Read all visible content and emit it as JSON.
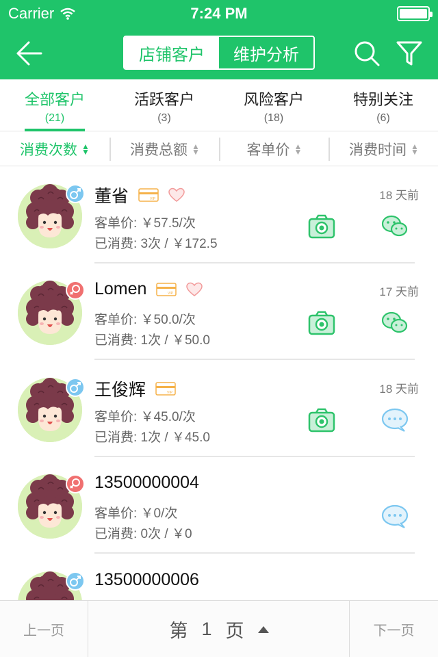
{
  "status": {
    "carrier": "Carrier",
    "time": "7:24 PM"
  },
  "header": {
    "segments": [
      {
        "label": "店铺客户",
        "active": true
      },
      {
        "label": "维护分析",
        "active": false
      }
    ],
    "icons": {
      "back": "back-arrow-icon",
      "search": "search-icon",
      "filter": "filter-icon"
    }
  },
  "tabs": [
    {
      "label": "全部客户",
      "count": "(21)",
      "active": true
    },
    {
      "label": "活跃客户",
      "count": "(3)",
      "active": false
    },
    {
      "label": "风险客户",
      "count": "(18)",
      "active": false
    },
    {
      "label": "特别关注",
      "count": "(6)",
      "active": false
    }
  ],
  "sort": [
    {
      "label": "消费次数",
      "active": true
    },
    {
      "label": "消费总额",
      "active": false
    },
    {
      "label": "客单价",
      "active": false
    },
    {
      "label": "消费时间",
      "active": false
    }
  ],
  "customers": [
    {
      "name": "董省",
      "gender": "male",
      "vip": true,
      "favorite": true,
      "ago": "18 天前",
      "unit_price": "客单价: ￥57.5/次",
      "spent": "已消费: 3次 / ￥172.5",
      "has_camera": true,
      "chat": "wechat"
    },
    {
      "name": "Lomen",
      "gender": "female",
      "vip": true,
      "favorite": true,
      "ago": "17 天前",
      "unit_price": "客单价: ￥50.0/次",
      "spent": "已消费: 1次 / ￥50.0",
      "has_camera": true,
      "chat": "wechat"
    },
    {
      "name": "王俊辉",
      "gender": "male",
      "vip": true,
      "favorite": false,
      "ago": "18 天前",
      "unit_price": "客单价: ￥45.0/次",
      "spent": "已消费: 1次 / ￥45.0",
      "has_camera": true,
      "chat": "sms"
    },
    {
      "name": "13500000004",
      "gender": "female",
      "vip": false,
      "favorite": false,
      "ago": "",
      "unit_price": "客单价: ￥0/次",
      "spent": "已消费: 0次 / ￥0",
      "has_camera": false,
      "chat": "sms"
    },
    {
      "name": "13500000006",
      "gender": "male",
      "vip": false,
      "favorite": false,
      "ago": "",
      "unit_price": "",
      "spent": "",
      "has_camera": false,
      "chat": ""
    }
  ],
  "footer": {
    "prev": "上一页",
    "page_label_a": "第",
    "page_num": "1",
    "page_label_b": "页",
    "next": "下一页"
  },
  "colors": {
    "accent": "#1fc46a",
    "male": "#7cc7f0",
    "female": "#f07070",
    "vip": "#f5b24a",
    "heart": "#f29a9a",
    "sms": "#7cc7f0"
  }
}
